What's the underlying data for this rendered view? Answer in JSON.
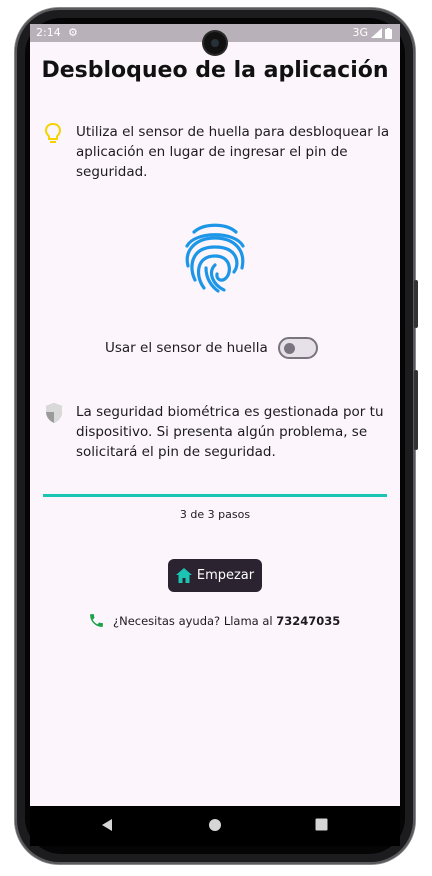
{
  "status": {
    "time": "2:14",
    "network": "3G"
  },
  "page": {
    "title": "Desbloqueo de la aplicación",
    "intro": "Utiliza el sensor de huella para desbloquear la aplicación en lugar de ingresar el pin de seguridad.",
    "toggle_label": "Usar el sensor de huella",
    "toggle_on": false,
    "security_note": "La seguridad biométrica es gestionada por tu dispositivo. Si presenta algún problema, se solicitará el pin de seguridad.",
    "steps": "3 de 3 pasos",
    "progress_fraction": 1.0,
    "start_label": "Empezar",
    "help_text": "¿Necesitas ayuda? Llama al ",
    "help_phone": "73247035"
  },
  "colors": {
    "accent": "#1cc4b4",
    "fingerprint": "#1e96e8",
    "bulb": "#f5d300",
    "phone": "#1aa34a",
    "button": "#2b2430"
  },
  "icons": [
    "settings-icon",
    "signal-icon",
    "battery-icon",
    "lightbulb-icon",
    "fingerprint-icon",
    "shield-icon",
    "home-icon",
    "phone-icon",
    "back-icon",
    "home-nav-icon",
    "recents-icon"
  ]
}
